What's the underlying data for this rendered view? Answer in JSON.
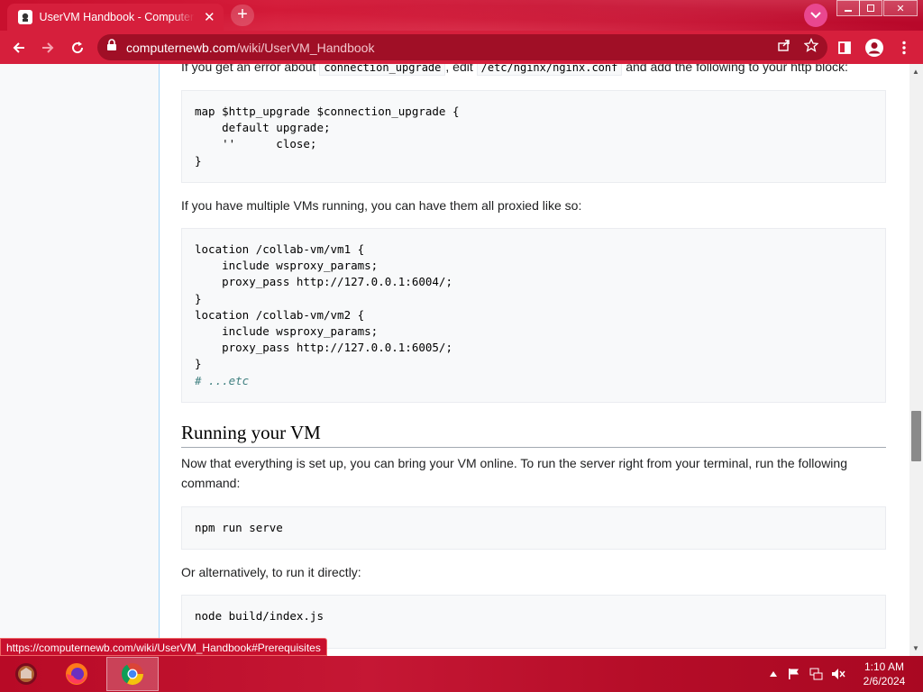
{
  "browser": {
    "tab_title": "UserVM Handbook - Computernewb Wiki",
    "url_host": "computernewb.com",
    "url_path": "/wiki/UserVM_Handbook",
    "status_url": "https://computernewb.com/wiki/UserVM_Handbook#Prerequisites"
  },
  "article": {
    "intro_pre": "If you get an error about",
    "intro_code1": "connection_upgrade",
    "intro_mid": ", edit",
    "intro_code2": "/etc/nginx/nginx.conf",
    "intro_post": "and add the following to your http block:",
    "code1": [
      "map $http_upgrade $connection_upgrade {",
      "    default upgrade;",
      "    ''      close;",
      "}"
    ],
    "multi_vm_text": "If you have multiple VMs running, you can have them all proxied like so:",
    "code2": [
      "location /collab-vm/vm1 {",
      "    include wsproxy_params;",
      "    proxy_pass http://127.0.0.1:6004/;",
      "}",
      "location /collab-vm/vm2 {",
      "    include wsproxy_params;",
      "    proxy_pass http://127.0.0.1:6005/;",
      "}",
      "# ...etc"
    ],
    "heading_running": "Running your VM",
    "running_text": "Now that everything is set up, you can bring your VM online. To run the server right from your terminal, run the following command:",
    "code3": "npm run serve",
    "alt_text": "Or alternatively, to run it directly:",
    "code4": "node build/index.js"
  },
  "taskbar": {
    "time": "1:10 AM",
    "date": "2/6/2024"
  },
  "colors": {
    "chrome_red": "#d61f3c",
    "omnibox_red": "#a00f26",
    "taskbar_red": "#c51734"
  },
  "icons": [
    "favicon-icon",
    "close-icon",
    "plus-icon",
    "back-icon",
    "forward-icon",
    "reload-icon",
    "lock-icon",
    "share-icon",
    "star-icon",
    "sidebar-icon",
    "profile-icon",
    "menu-icon",
    "firefox-icon",
    "chrome-icon",
    "flag-icon",
    "network-icon",
    "volume-icon"
  ]
}
